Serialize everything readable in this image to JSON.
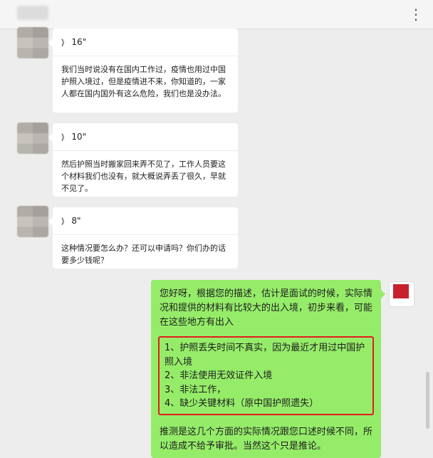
{
  "header": {
    "more_icon": "⋮"
  },
  "messages": [
    {
      "voice_duration": "16\"",
      "text": "我们当时说没有在国内工作过，疫情也用过中国护照入境过，但是疫情进不来，你知道的，一家人都在国内国外有这么危险，我们也是没办法。"
    },
    {
      "voice_duration": "10\"",
      "text": "然后护照当时搬家回来弄不见了，工作人员要这个材料我们也没有，就大概说弄丢了很久，早就不见了。"
    },
    {
      "voice_duration": "8\"",
      "text": "这种情况要怎么办？还可以申请吗？你们办的话要多少钱呢？"
    }
  ],
  "reply": {
    "intro": "您好呀，根据您的描述，估计是面试的时候，实际情况和提供的材料有比较大的出入境，初步来看，可能在这些地方有出入",
    "points": [
      "1、护照丢失时间不真实，因为最近才用过中国护照入境",
      "2、非法使用无效证件入境",
      "3、非法工作，",
      "4、缺少关键材料（原中国护照遗失）"
    ],
    "tail": "推测是这几个方面的实际情况跟您口述时候不同，所以造成不给予审批。当然这个只是推论。"
  },
  "icons": {
    "voice": "voice-wave-icon",
    "more": "more-vertical-icon"
  },
  "colors": {
    "background": "#ededed",
    "incoming_bubble": "#ffffff",
    "outgoing_bubble": "#95ec69",
    "highlight_border": "#e21d1d"
  }
}
